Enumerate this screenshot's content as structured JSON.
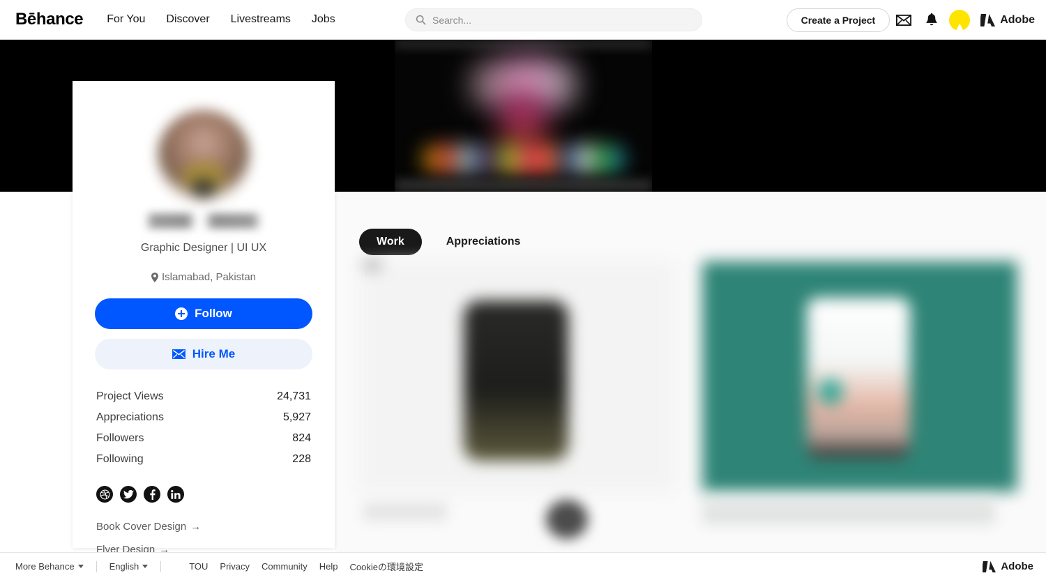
{
  "header": {
    "logo": "Bēhance",
    "nav": [
      {
        "label": "For You"
      },
      {
        "label": "Discover"
      },
      {
        "label": "Livestreams"
      },
      {
        "label": "Jobs"
      }
    ],
    "search": {
      "value": "",
      "placeholder": "Search..."
    },
    "create_project_label": "Create a Project",
    "icons": {
      "mail": "mail-icon",
      "bell": "bell-icon",
      "avatar": "user-avatar"
    },
    "adobe_label": "Adobe",
    "avatar_color": "#ffe400"
  },
  "profile": {
    "name": "",
    "headline": "Graphic Designer | UI UX",
    "location": "Islamabad, Pakistan",
    "follow_label": "Follow",
    "hire_label": "Hire Me",
    "stats": [
      {
        "label": "Project Views",
        "value": "24,731"
      },
      {
        "label": "Appreciations",
        "value": "5,927"
      },
      {
        "label": "Followers",
        "value": "824"
      },
      {
        "label": "Following",
        "value": "228"
      }
    ],
    "socials": [
      {
        "name": "dribbble-icon"
      },
      {
        "name": "twitter-icon"
      },
      {
        "name": "facebook-icon"
      },
      {
        "name": "linkedin-icon"
      }
    ],
    "links": [
      {
        "label": "Book Cover Design",
        "arrow": "→"
      },
      {
        "label": "Flyer Design",
        "arrow": "→"
      }
    ]
  },
  "main": {
    "tabs": [
      {
        "label": "Work",
        "active": true
      },
      {
        "label": "Appreciations",
        "active": false
      }
    ],
    "projects": [
      {
        "title": "",
        "accent": "#f3f3f3"
      },
      {
        "title": "",
        "accent": "#2e8476"
      }
    ]
  },
  "footer": {
    "more_behance": "More Behance",
    "language": "English",
    "links": [
      {
        "label": "TOU"
      },
      {
        "label": "Privacy"
      },
      {
        "label": "Community"
      },
      {
        "label": "Help"
      },
      {
        "label": "Cookieの環境設定"
      }
    ],
    "adobe_label": "Adobe"
  },
  "colors": {
    "brand_blue": "#0057ff",
    "hire_bg": "#eef2fb",
    "tab_active_bg": "#191919",
    "thumb_teal": "#2e8476",
    "avatar_yellow": "#ffe400"
  }
}
